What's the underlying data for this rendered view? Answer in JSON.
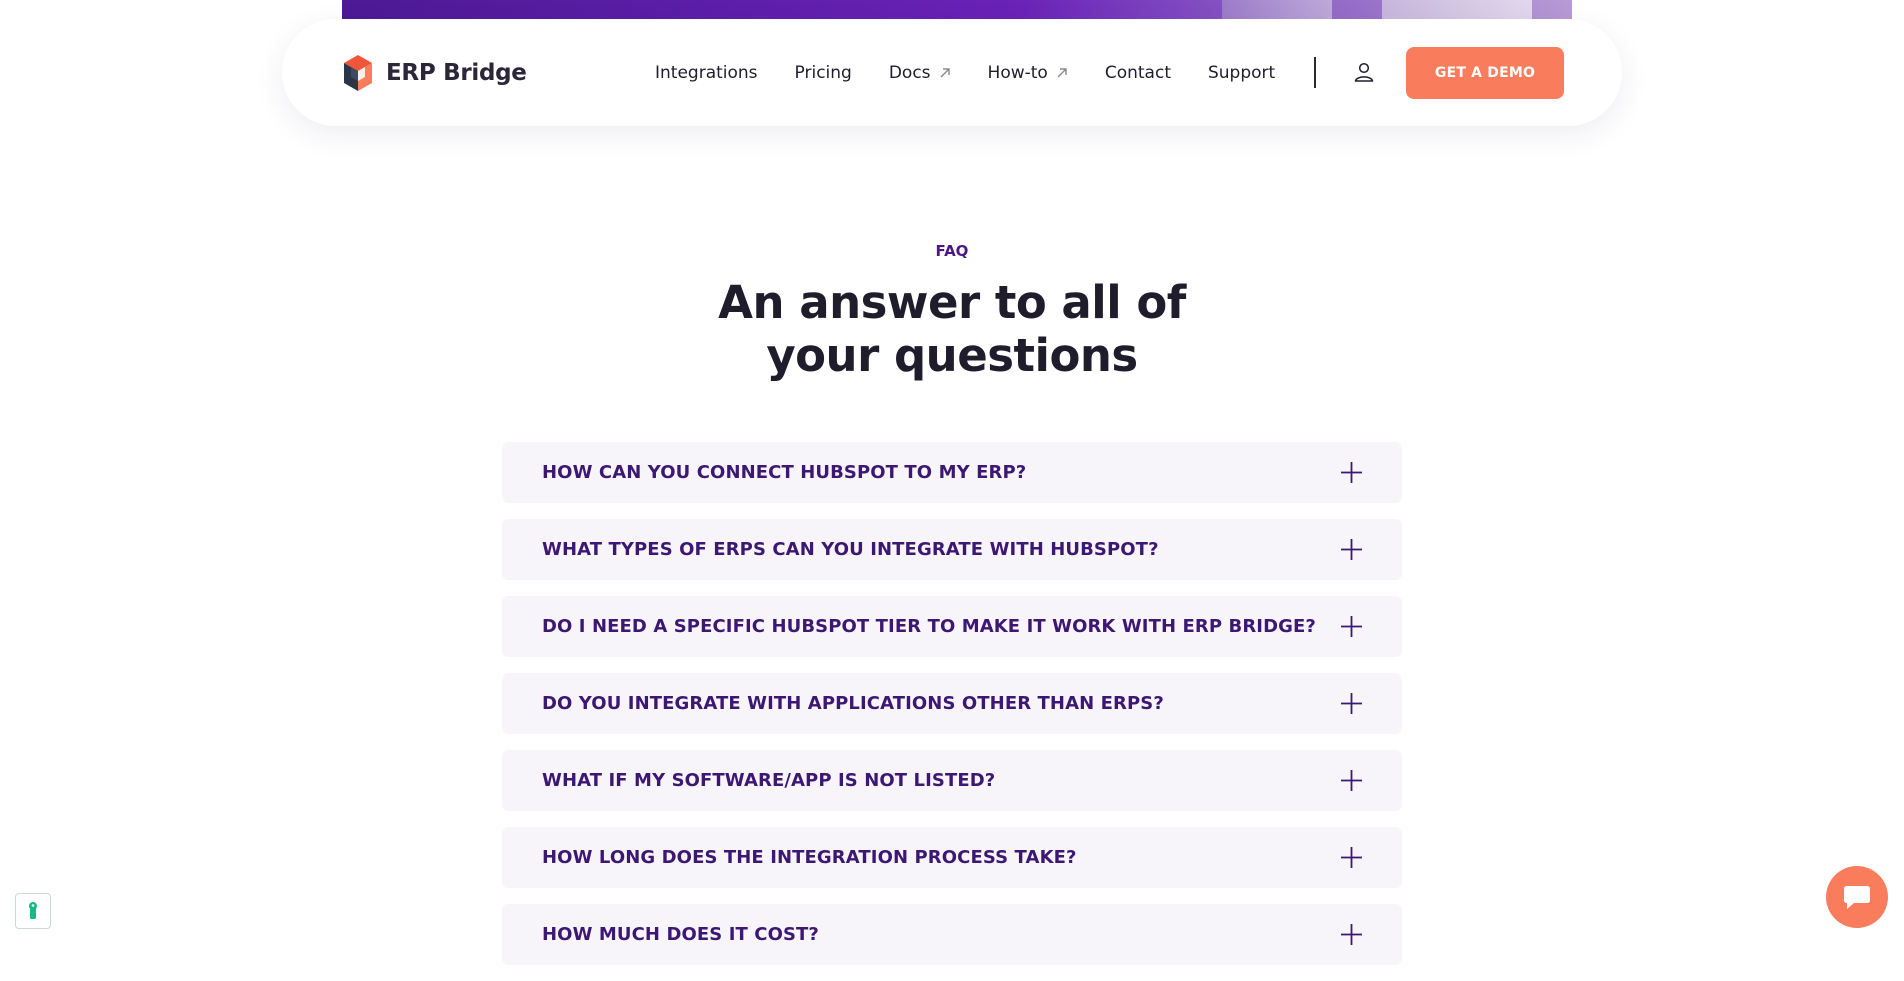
{
  "brand": {
    "name": "ERP Bridge"
  },
  "nav": {
    "links": [
      {
        "label": "Integrations",
        "external": false
      },
      {
        "label": "Pricing",
        "external": false
      },
      {
        "label": "Docs",
        "external": true
      },
      {
        "label": "How-to",
        "external": true
      },
      {
        "label": "Contact",
        "external": false
      },
      {
        "label": "Support",
        "external": false
      }
    ],
    "user_icon": "user-icon",
    "demo_label": "GET A DEMO"
  },
  "faq": {
    "eyebrow": "FAQ",
    "title_line1": "An answer to all of",
    "title_line2": "your questions",
    "items": [
      {
        "question": "HOW CAN YOU CONNECT HUBSPOT TO MY ERP?"
      },
      {
        "question": "WHAT TYPES OF ERPS CAN YOU INTEGRATE WITH HUBSPOT?"
      },
      {
        "question": "DO I NEED A SPECIFIC HUBSPOT TIER TO MAKE IT WORK WITH ERP BRIDGE?"
      },
      {
        "question": "DO YOU INTEGRATE WITH APPLICATIONS OTHER THAN ERPS?"
      },
      {
        "question": "WHAT IF MY SOFTWARE/APP IS NOT LISTED?"
      },
      {
        "question": "HOW LONG DOES THE INTEGRATION PROCESS TAKE?"
      },
      {
        "question": "HOW MUCH DOES IT COST?"
      }
    ]
  },
  "colors": {
    "accent": "#f97d5c",
    "primary_purple": "#3c1872",
    "hero_purple": "#5b1fa8",
    "faq_bg": "#f7f5fa"
  }
}
